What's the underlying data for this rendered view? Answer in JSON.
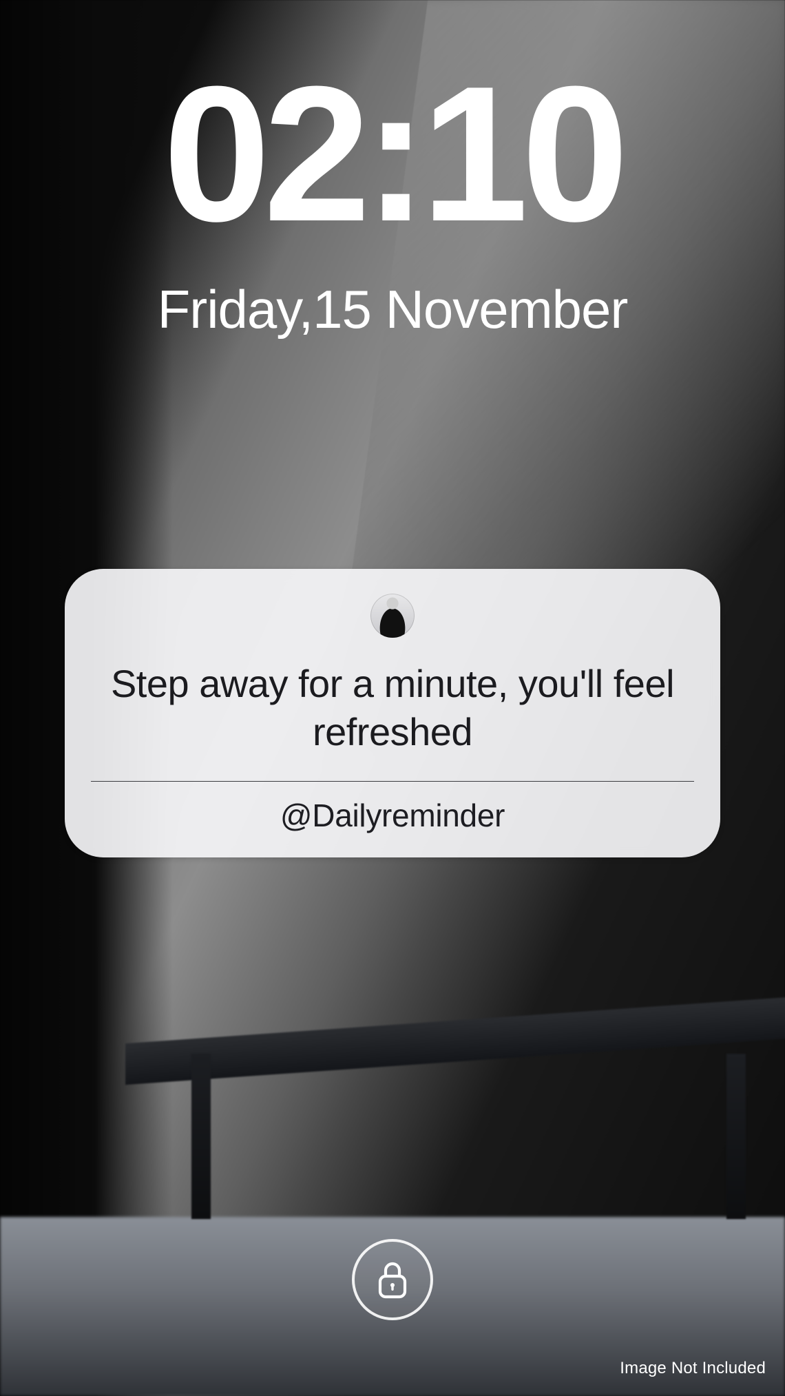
{
  "lockscreen": {
    "time": "02:10",
    "date": "Friday,15 November"
  },
  "notification": {
    "avatar_name": "profile-avatar",
    "message": "Step away for a minute, you'll feel refreshed",
    "source": "@Dailyreminder"
  },
  "footer": {
    "attribution": "Image Not Included"
  },
  "icons": {
    "lock": "lock-icon"
  }
}
